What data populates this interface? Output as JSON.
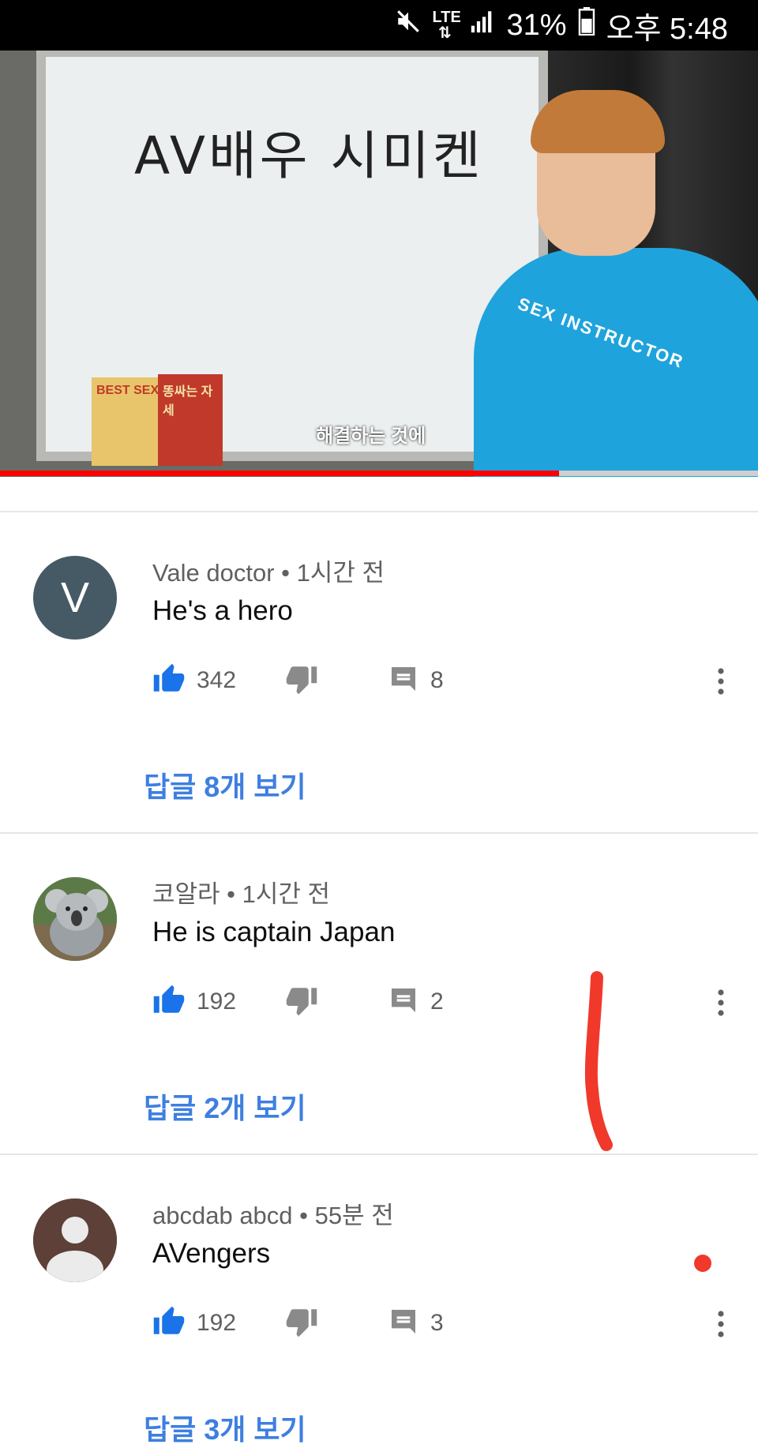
{
  "status_bar": {
    "lte": "LTE",
    "battery": "31%",
    "time": "오후 5:48"
  },
  "video": {
    "board_text": "AV배우 시미켄",
    "book1_text": "BEST SEX",
    "book2_text": "똥싸는 자세",
    "shirt_text": "SEX INSTRUCTOR",
    "subtitle": "해결하는 것에",
    "progress": 0.737
  },
  "comments": [
    {
      "author": "Vale doctor",
      "time": "1시간 전",
      "text": "He's a hero",
      "avatar_letter": "V",
      "likes": "342",
      "replies_count": "8",
      "replies_prefix": "답글 ",
      "replies_num": "8",
      "replies_suffix": "개 보기"
    },
    {
      "author": "코알라",
      "time": "1시간 전",
      "text": "He is captain Japan",
      "avatar_letter": "",
      "likes": "192",
      "replies_count": "2",
      "replies_prefix": "답글 ",
      "replies_num": "2",
      "replies_suffix": "개 보기"
    },
    {
      "author": "abcdab abcd",
      "time": "55분 전",
      "text": "AVengers",
      "avatar_letter": "",
      "likes": "192",
      "replies_count": "3",
      "replies_prefix": "답글 ",
      "replies_num": "3",
      "replies_suffix": "개 보기"
    }
  ],
  "meta_separator": " • ",
  "colors": {
    "accent_blue": "#3e7fe0",
    "like_blue": "#1a73e8",
    "progress_red": "#ff0000",
    "annotation_red": "#f0392b"
  }
}
